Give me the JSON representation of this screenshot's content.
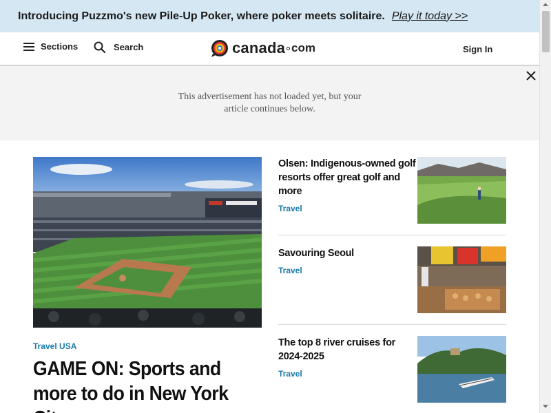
{
  "promo": {
    "text": "Introducing Puzzmo's new Pile-Up Poker, where poker meets solitaire.",
    "link": "Play it today >>"
  },
  "header": {
    "sections_label": "Sections",
    "search_label": "Search",
    "logo": {
      "name": "canada",
      "suffix": "com"
    },
    "signin_label": "Sign In"
  },
  "ad": {
    "line1": "This advertisement has not loaded yet, but your",
    "line2": "article continues below."
  },
  "main_story": {
    "kicker": "Travel USA",
    "headline": "GAME ON: Sports and more to do in New York City"
  },
  "side_stories": [
    {
      "title": "Olsen: Indigenous-owned golf resorts offer great golf and more",
      "category": "Travel"
    },
    {
      "title": "Savouring Seoul",
      "category": "Travel"
    },
    {
      "title": "The top 8 river cruises for 2024-2025",
      "category": "Travel"
    }
  ],
  "colors": {
    "banner_bg": "#d4e7f2",
    "accent": "#1a7aa8",
    "ad_bg": "#f3f3f3"
  },
  "icons": {
    "menu": "hamburger-icon",
    "search": "search-icon",
    "close": "close-icon"
  }
}
